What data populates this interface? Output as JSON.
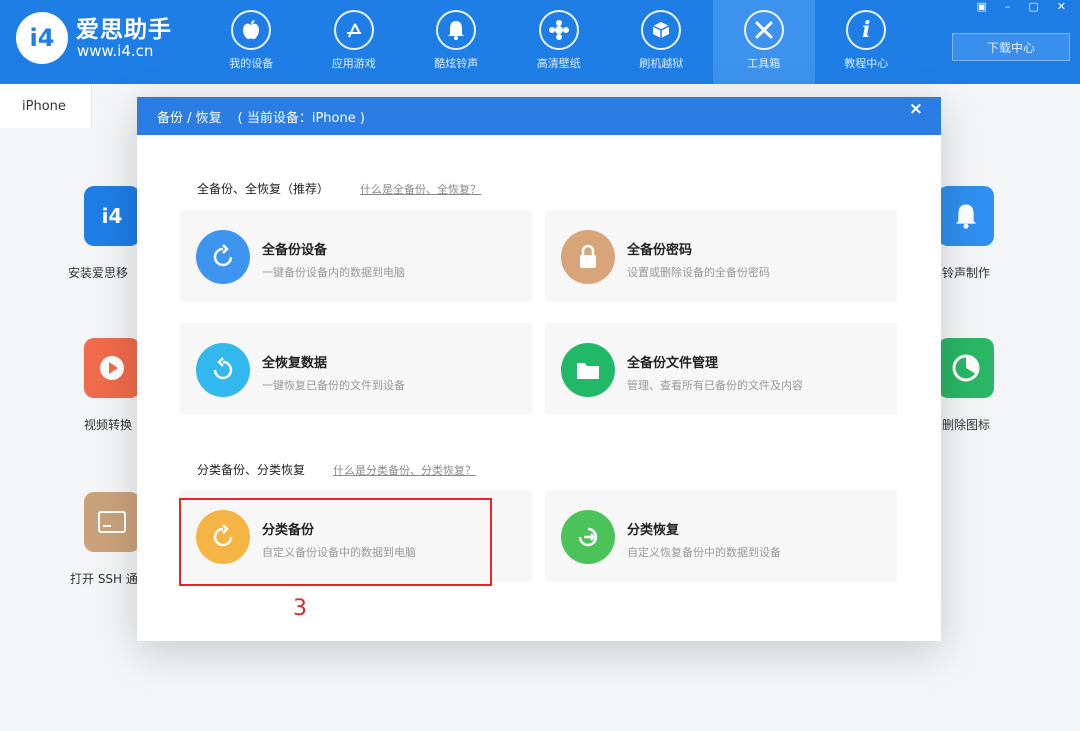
{
  "app": {
    "logo_mark": "i4",
    "name": "爱思助手",
    "url": "www.i4.cn"
  },
  "nav": {
    "items": [
      {
        "label": "我的设备",
        "icon": "apple-icon",
        "glyph": ""
      },
      {
        "label": "应用游戏",
        "icon": "app-store-icon",
        "glyph": "A"
      },
      {
        "label": "酷炫铃声",
        "icon": "bell-icon",
        "glyph": "🔔"
      },
      {
        "label": "高清壁纸",
        "icon": "flower-icon",
        "glyph": "✿"
      },
      {
        "label": "刷机越狱",
        "icon": "box-icon",
        "glyph": "⬡"
      },
      {
        "label": "工具箱",
        "icon": "tools-icon",
        "glyph": "✕"
      },
      {
        "label": "教程中心",
        "icon": "info-icon",
        "glyph": "i"
      }
    ],
    "active_index": 5
  },
  "window": {
    "download_center": "下载中心",
    "controls": [
      "▣",
      "–",
      "▢",
      "✕"
    ]
  },
  "device_tab": "iPhone",
  "background_tiles": [
    {
      "label": "安装爱思移",
      "color": "#1f7ee6",
      "glyph": "i4"
    },
    {
      "label": "视频转换",
      "color": "#ef6b4b",
      "glyph": "▶"
    },
    {
      "label": "打开 SSH 通",
      "color": "#c9a27b",
      "glyph": "▭"
    },
    {
      "label": "铃声制作",
      "color": "#2f8ff0",
      "glyph": "🔔"
    },
    {
      "label": "删除图标",
      "color": "#29b765",
      "glyph": "◔"
    }
  ],
  "modal": {
    "title": "备份 / 恢复",
    "current_device": "( 当前设备：iPhone )",
    "close": "×",
    "section1": {
      "title": "全备份、全恢复（推荐）",
      "link": "什么是全备份、全恢复？"
    },
    "section2": {
      "title": "分类备份、分类恢复",
      "link": "什么是分类备份、分类恢复？"
    },
    "cards": [
      {
        "title": "全备份设备",
        "desc": "一键备份设备内的数据到电脑",
        "color": "#3d95ef",
        "icon": "backup-icon",
        "glyph": "↻"
      },
      {
        "title": "全备份密码",
        "desc": "设置或删除设备的全备份密码",
        "color": "#d8a47a",
        "icon": "lock-icon",
        "glyph": "🔒"
      },
      {
        "title": "全恢复数据",
        "desc": "一键恢复已备份的文件到设备",
        "color": "#33b8ee",
        "icon": "restore-icon",
        "glyph": "↺"
      },
      {
        "title": "全备份文件管理",
        "desc": "管理、查看所有已备份的文件及内容",
        "color": "#21b868",
        "icon": "folder-icon",
        "glyph": "▭"
      },
      {
        "title": "分类备份",
        "desc": "自定义备份设备中的数据到电脑",
        "color": "#f5b544",
        "icon": "category-backup-icon",
        "glyph": "↻"
      },
      {
        "title": "分类恢复",
        "desc": "自定义恢复备份中的数据到设备",
        "color": "#4cc35a",
        "icon": "category-restore-icon",
        "glyph": "⇥"
      }
    ]
  },
  "annotation": {
    "step": "3",
    "color": "#e2262a"
  }
}
